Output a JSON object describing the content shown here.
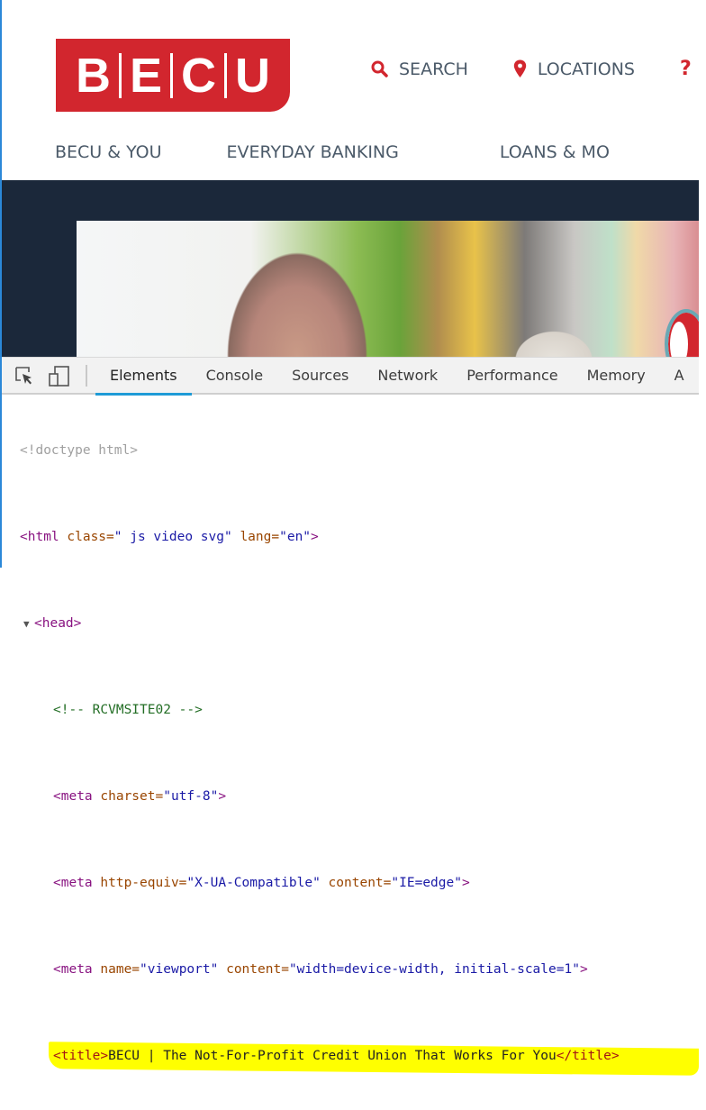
{
  "site": {
    "logo": {
      "letters": [
        "B",
        "E",
        "C",
        "U"
      ],
      "brand_color": "#d2262e"
    },
    "utility_nav": [
      {
        "icon": "search-icon",
        "label": "SEARCH"
      },
      {
        "icon": "location-pin-icon",
        "label": "LOCATIONS"
      },
      {
        "icon": "help-icon",
        "label": "?"
      }
    ],
    "main_nav": [
      {
        "label": "BECU & YOU"
      },
      {
        "label": "EVERYDAY BANKING"
      },
      {
        "label": "LOANS & MO"
      }
    ],
    "hero": {
      "image_description": "Older bald man and white-haired woman on a colorful street",
      "band_color": "#1b283a"
    }
  },
  "devtools": {
    "tools": [
      {
        "icon": "select-element-icon"
      },
      {
        "icon": "device-emulation-icon"
      }
    ],
    "tabs": [
      {
        "label": "Elements",
        "active": true
      },
      {
        "label": "Console",
        "active": false
      },
      {
        "label": "Sources",
        "active": false
      },
      {
        "label": "Network",
        "active": false
      },
      {
        "label": "Performance",
        "active": false
      },
      {
        "label": "Memory",
        "active": false
      },
      {
        "label": "A",
        "active": false
      }
    ],
    "accent_color": "#1e9bd7",
    "dom": {
      "doctype": "<!doctype html>",
      "html_line": {
        "open": "<html",
        "attr1_name": " class=",
        "attr1_val": "\" js video svg\"",
        "attr2_name": " lang=",
        "attr2_val": "\"en\"",
        "close": ">"
      },
      "head_line": {
        "twisty": "▼",
        "tag": "<head>"
      },
      "comment": "<!-- RCVMSITE02 -->",
      "meta_charset": {
        "open": "<meta",
        "attr_name": " charset=",
        "attr_val": "\"utf-8\"",
        "close": ">"
      },
      "meta_http_equiv": {
        "open": "<meta",
        "attr1_name": " http-equiv=",
        "attr1_val": "\"X-UA-Compatible\"",
        "attr2_name": " content=",
        "attr2_val": "\"IE=edge\"",
        "close": ">"
      },
      "meta_viewport": {
        "open": "<meta",
        "attr1_name": " name=",
        "attr1_val": "\"viewport\"",
        "attr2_name": " content=",
        "attr2_val": "\"width=device-width, initial-scale=1\"",
        "close": ">"
      },
      "title_line": {
        "open": "<title>",
        "text": "BECU | The Not-For-Profit Credit Union That Works For You",
        "close": "</title>",
        "highlighted": true,
        "highlight_color": "#ffff00"
      }
    }
  }
}
